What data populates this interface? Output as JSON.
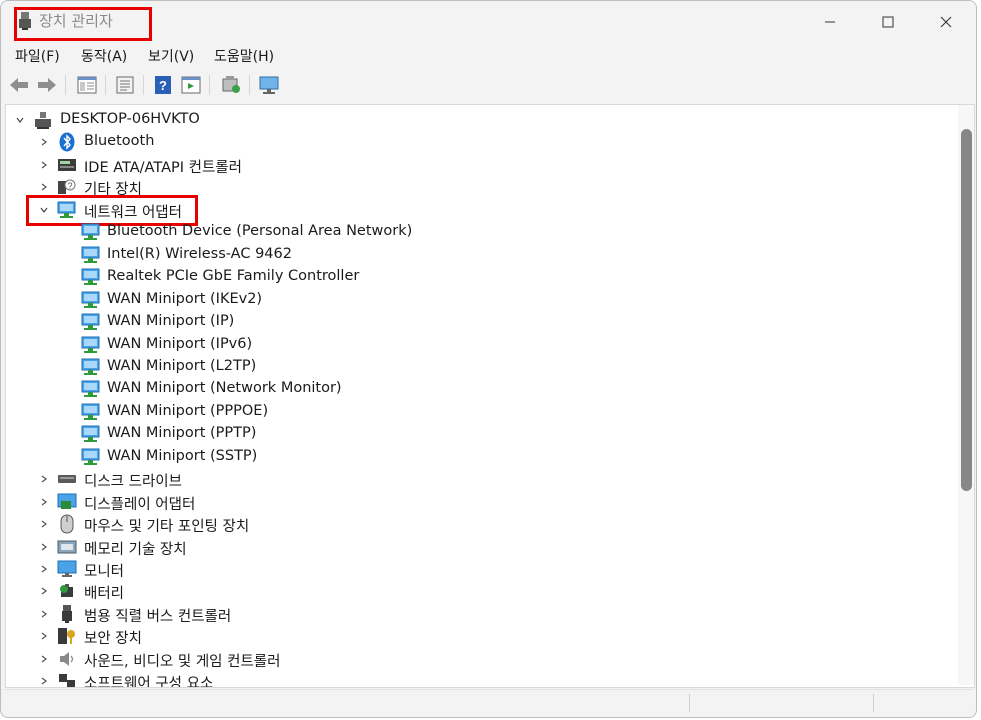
{
  "window": {
    "title": "장치 관리자",
    "minimize_glyph": "—",
    "maximize_glyph": "☐",
    "close_glyph": "✕"
  },
  "menu": [
    "파일(F)",
    "동작(A)",
    "보기(V)",
    "도움말(H)"
  ],
  "toolbar": {
    "buttons": [
      "back-icon",
      "forward-icon",
      "show-hide-console-tree-icon",
      "properties-icon",
      "help-icon",
      "show-action-pane-icon",
      "update-driver-icon",
      "scan-hardware-changes-icon"
    ]
  },
  "tree": {
    "root": "DESKTOP-06HVKTO",
    "categories_top": [
      {
        "label": "Bluetooth",
        "icon": "bluetooth-icon"
      },
      {
        "label": "IDE ATA/ATAPI 컨트롤러",
        "icon": "ide-controller-icon"
      },
      {
        "label": "기타 장치",
        "icon": "other-devices-icon"
      }
    ],
    "expanded_category": {
      "label": "네트워크 어댑터",
      "icon": "network-adapter-icon"
    },
    "network_devices": [
      "Bluetooth Device (Personal Area Network)",
      "Intel(R) Wireless-AC 9462",
      "Realtek PCIe GbE Family Controller",
      "WAN Miniport (IKEv2)",
      "WAN Miniport (IP)",
      "WAN Miniport (IPv6)",
      "WAN Miniport (L2TP)",
      "WAN Miniport (Network Monitor)",
      "WAN Miniport (PPPOE)",
      "WAN Miniport (PPTP)",
      "WAN Miniport (SSTP)"
    ],
    "categories_bottom": [
      {
        "label": "디스크 드라이브",
        "icon": "disk-drive-icon"
      },
      {
        "label": "디스플레이 어댑터",
        "icon": "display-adapter-icon"
      },
      {
        "label": "마우스 및 기타 포인팅 장치",
        "icon": "mouse-icon"
      },
      {
        "label": "메모리 기술 장치",
        "icon": "memory-device-icon"
      },
      {
        "label": "모니터",
        "icon": "monitor-icon"
      },
      {
        "label": "배터리",
        "icon": "battery-icon"
      },
      {
        "label": "범용 직렬 버스 컨트롤러",
        "icon": "usb-controller-icon"
      },
      {
        "label": "보안 장치",
        "icon": "security-device-icon"
      },
      {
        "label": "사운드, 비디오 및 게임 컨트롤러",
        "icon": "sound-icon"
      },
      {
        "label": "소프트웨어 구성 요소",
        "icon": "software-component-icon"
      }
    ]
  },
  "colors": {
    "highlight": "#e60000",
    "network_blue": "#1f7fd6",
    "network_green": "#2e9b3a",
    "bluetooth_blue": "#1b6fd1"
  }
}
